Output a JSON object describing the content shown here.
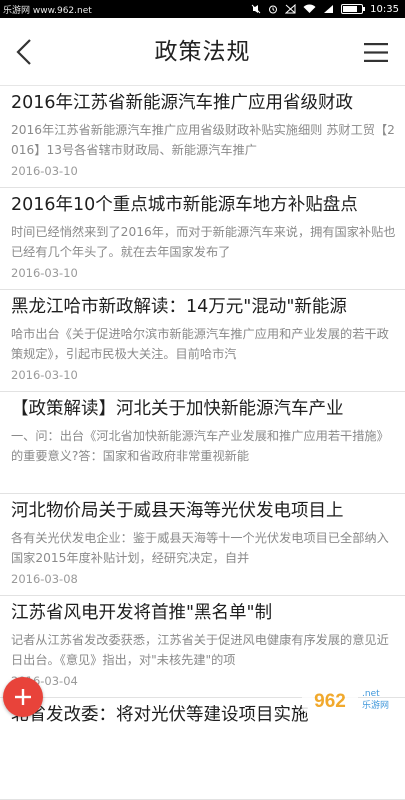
{
  "status_bar": {
    "site": "乐游网 www.962.net",
    "time": "10:35"
  },
  "header": {
    "title": "政策法规"
  },
  "articles": [
    {
      "title": "2016年江苏省新能源汽车推广应用省级财政",
      "summary": "2016年江苏省新能源汽车推广应用省级财政补贴实施细则 苏财工贸【2016】13号各省辖市财政局、新能源汽车推广",
      "date": "2016-03-10"
    },
    {
      "title": "2016年10个重点城市新能源车地方补贴盘点",
      "summary": "时间已经悄然来到了2016年，而对于新能源汽车来说，拥有国家补贴也已经有几个年头了。就在去年国家发布了",
      "date": "2016-03-10"
    },
    {
      "title": "黑龙江哈市新政解读：14万元\"混动\"新能源",
      "summary": "哈市出台《关于促进哈尔滨市新能源汽车推广应用和产业发展的若干政策规定》，引起市民极大关注。目前哈市汽",
      "date": "2016-03-10"
    },
    {
      "title": "【政策解读】河北关于加快新能源汽车产业",
      "summary": "一、问：出台《河北省加快新能源汽车产业发展和推广应用若干措施》的重要意义?答：国家和省政府非常重视新能",
      "date": ""
    },
    {
      "title": "河北物价局关于威县天海等光伏发电项目上",
      "summary": "各有关光伏发电企业：鉴于威县天海等十一个光伏发电项目已全部纳入国家2015年度补贴计划，经研究决定，自并",
      "date": "2016-03-08"
    },
    {
      "title": "江苏省风电开发将首推\"黑名单\"制",
      "summary": "记者从江苏省发改委获悉，江苏省关于促进风电健康有序发展的意见近日出台。《意见》指出，对\"未核先建\"的项",
      "date": "2016-03-04"
    },
    {
      "title": "北省发改委：将对光伏等建设项目实施",
      "summary": "",
      "date": ""
    }
  ],
  "watermark": {
    "brand": "962",
    "suffix": ".net",
    "name": "乐游网"
  },
  "colors": {
    "accent": "#e8433a",
    "title_text": "#1e1e1e",
    "summary_text": "#8a8a8a",
    "divider": "#e2e2e2"
  },
  "icons": [
    "back-arrow-icon",
    "menu-icon",
    "plus-icon",
    "signal-icon",
    "wifi-icon",
    "battery-icon"
  ]
}
